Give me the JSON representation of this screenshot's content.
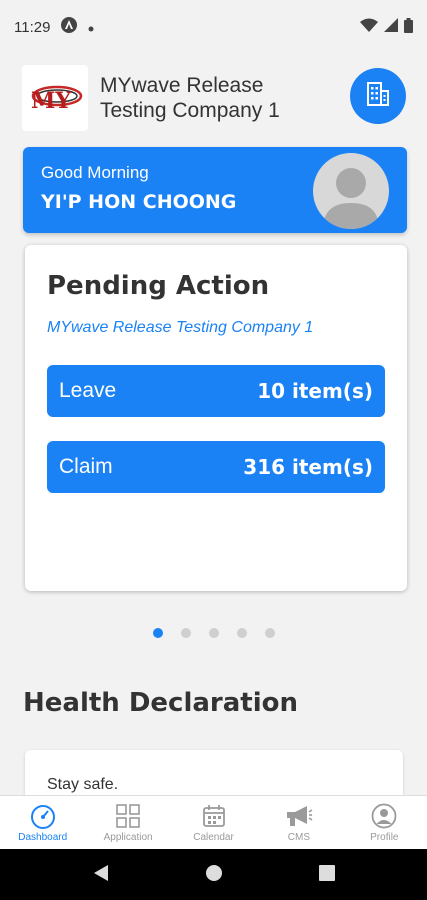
{
  "status_bar": {
    "time": "11:29"
  },
  "header": {
    "company_name": "MYwave Release Testing Company 1",
    "logo_text": "MY"
  },
  "greeting_card": {
    "greeting": "Good Morning",
    "username": "YI'P HON CHOONG"
  },
  "pending": {
    "title": "Pending Action",
    "company": "MYwave Release Testing Company 1",
    "rows": [
      {
        "label": "Leave",
        "count": "10 item(s)"
      },
      {
        "label": "Claim",
        "count": "316 item(s)"
      }
    ]
  },
  "carousel": {
    "pages": 5,
    "active_index": 0
  },
  "health": {
    "title": "Health Declaration",
    "message": "Stay safe."
  },
  "bottom_nav": {
    "items": [
      {
        "label": "Dashboard",
        "icon": "speedometer-icon",
        "active": true
      },
      {
        "label": "Application",
        "icon": "grid-icon",
        "active": false
      },
      {
        "label": "Calendar",
        "icon": "calendar-icon",
        "active": false
      },
      {
        "label": "CMS",
        "icon": "megaphone-icon",
        "active": false
      },
      {
        "label": "Profile",
        "icon": "profile-icon",
        "active": false
      }
    ]
  },
  "colors": {
    "accent": "#1a82f5",
    "background": "#f2f2f2",
    "inactive": "#9a9a9a"
  }
}
